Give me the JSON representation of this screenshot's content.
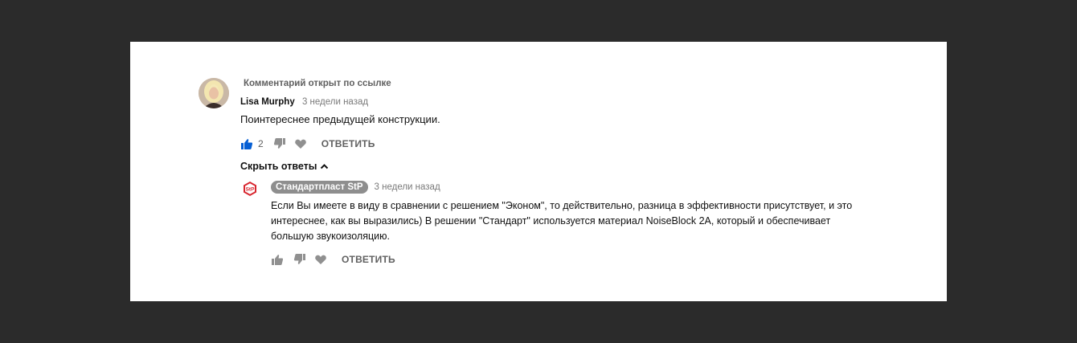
{
  "comment": {
    "pinned_label": "Комментарий открыт по ссылке",
    "author": "Lisa Murphy",
    "time": "3 недели назад",
    "text": "Поинтереснее предыдущей конструкции.",
    "likes": "2",
    "reply_label": "ОТВЕТИТЬ",
    "hide_replies_label": "Скрыть ответы"
  },
  "reply": {
    "author": "Стандартпласт StP",
    "time": "3 недели назад",
    "text_lines": [
      "Если Вы имеете в виду в сравнении с решением \"Эконом\", то действительно, разница в эффективности присутствует, и это",
      "интереснее, как вы выразились) В решении \"Стандарт\" используется материал NoiseBlock 2A, который и обеспечивает",
      "большую звукоизоляцию."
    ],
    "reply_label": "ОТВЕТИТЬ",
    "logo_text": "StP"
  },
  "colors": {
    "like_active": "#065fd4",
    "icon_gray": "#909090",
    "logo_red": "#d8262f"
  }
}
